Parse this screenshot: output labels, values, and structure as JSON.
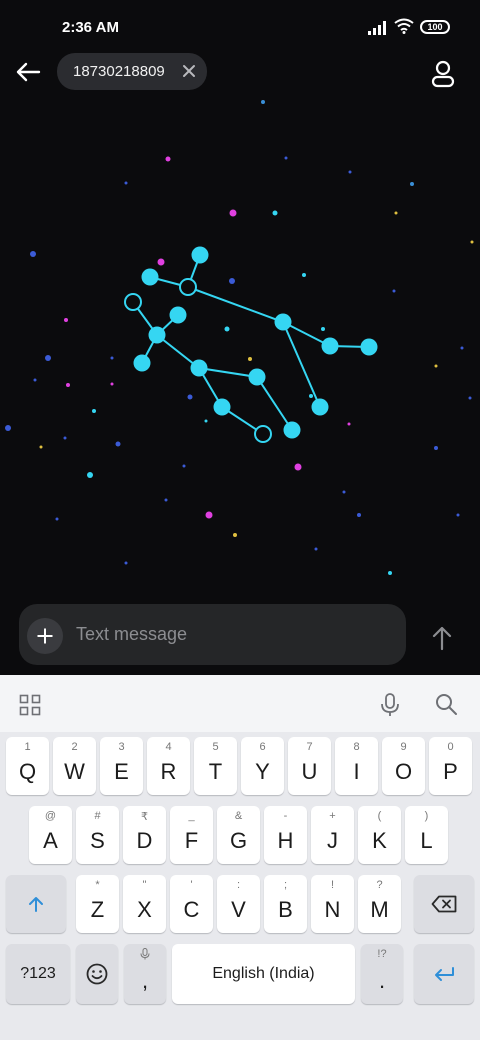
{
  "status": {
    "time": "2:36 AM",
    "battery": "100"
  },
  "header": {
    "recipient": "18730218809"
  },
  "composer": {
    "placeholder": "Text message"
  },
  "keyboard": {
    "row1": [
      {
        "letter": "Q",
        "hint": "1"
      },
      {
        "letter": "W",
        "hint": "2"
      },
      {
        "letter": "E",
        "hint": "3"
      },
      {
        "letter": "R",
        "hint": "4"
      },
      {
        "letter": "T",
        "hint": "5"
      },
      {
        "letter": "Y",
        "hint": "6"
      },
      {
        "letter": "U",
        "hint": "7"
      },
      {
        "letter": "I",
        "hint": "8"
      },
      {
        "letter": "O",
        "hint": "9"
      },
      {
        "letter": "P",
        "hint": "0"
      }
    ],
    "row2": [
      {
        "letter": "A",
        "hint": "@"
      },
      {
        "letter": "S",
        "hint": "#"
      },
      {
        "letter": "D",
        "hint": "₹"
      },
      {
        "letter": "F",
        "hint": "_"
      },
      {
        "letter": "G",
        "hint": "&"
      },
      {
        "letter": "H",
        "hint": "-"
      },
      {
        "letter": "J",
        "hint": "+"
      },
      {
        "letter": "K",
        "hint": "("
      },
      {
        "letter": "L",
        "hint": ")"
      }
    ],
    "row3": [
      {
        "letter": "Z",
        "hint": "*"
      },
      {
        "letter": "X",
        "hint": "\""
      },
      {
        "letter": "C",
        "hint": "'"
      },
      {
        "letter": "V",
        "hint": ":"
      },
      {
        "letter": "B",
        "hint": ";"
      },
      {
        "letter": "N",
        "hint": "!"
      },
      {
        "letter": "M",
        "hint": "?"
      }
    ],
    "symbols_label": "?123",
    "comma_label": ",",
    "space_label": "English (India)",
    "period_label": ".",
    "period_hint": "!?"
  },
  "colors": {
    "background": "#0b0b0d",
    "accent": "#35d6f2",
    "keyboard_bg": "#e8e9ed",
    "enter_blue": "#2f8fd8"
  },
  "icons": [
    "back-arrow-icon",
    "close-icon",
    "contact-icon",
    "plus-icon",
    "send-arrow-icon",
    "apps-grid-icon",
    "mic-icon",
    "search-icon",
    "shift-icon",
    "backspace-icon",
    "emoji-icon",
    "enter-icon"
  ]
}
